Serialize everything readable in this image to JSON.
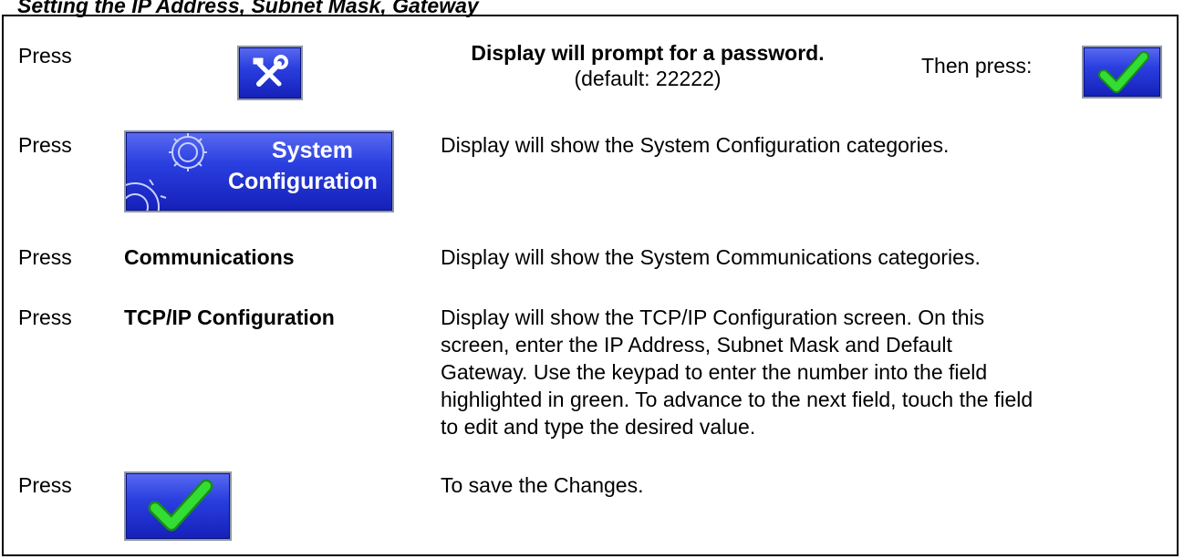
{
  "doc": {
    "title": "Setting the IP Address, Subnet Mask, Gateway"
  },
  "rows": [
    {
      "press": "Press",
      "bold_text": "Display will prompt for a password.",
      "sub_text": "(default: 22222)",
      "then": "Then press:"
    },
    {
      "press": "Press",
      "button_line1": "System",
      "button_line2": "Configuration",
      "desc": "Display will show the System Configuration categories."
    },
    {
      "press": "Press",
      "target": "Communications",
      "desc": "Display will show the System Communications categories."
    },
    {
      "press": "Press",
      "target": "TCP/IP Configuration",
      "desc_lines": [
        "Display will show the TCP/IP Configuration screen.  On this",
        "screen, enter the IP Address, Subnet Mask and Default",
        "Gateway.  Use the keypad to enter the number into the field",
        "highlighted in green.  To advance to the next field, touch the field",
        "to edit and type the desired value."
      ]
    },
    {
      "press": "Press",
      "desc": "To save the Changes."
    }
  ],
  "icons": [
    "tools-icon",
    "checkmark-icon",
    "gear-icon"
  ],
  "colors": {
    "button_blue": "#2a3fe0",
    "check_green": "#22cc22"
  }
}
